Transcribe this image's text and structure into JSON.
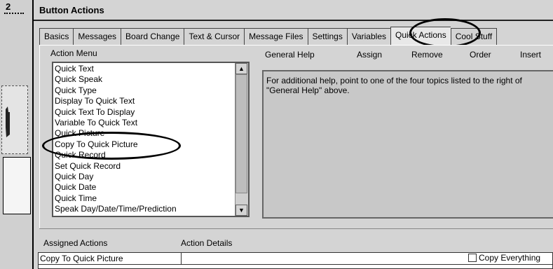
{
  "sidebar": {
    "page_number": "2"
  },
  "window": {
    "title": "Button Actions"
  },
  "tabs": [
    {
      "label": "Basics"
    },
    {
      "label": "Messages"
    },
    {
      "label": "Board Change"
    },
    {
      "label": "Text & Cursor"
    },
    {
      "label": "Message Files"
    },
    {
      "label": "Settings"
    },
    {
      "label": "Variables"
    },
    {
      "label": "Quick Actions"
    },
    {
      "label": "Cool Stuff"
    }
  ],
  "action_menu": {
    "label": "Action Menu",
    "items": [
      "Quick Text",
      "Quick Speak",
      "Quick Type",
      "Display To Quick Text",
      "Quick Text To Display",
      "Variable To Quick Text",
      "Quick Picture",
      "Copy To Quick Picture",
      "Quick Record",
      "Set Quick Record",
      "Quick Day",
      "Quick Date",
      "Quick Time",
      "Speak Day/Date/Time/Prediction"
    ]
  },
  "help": {
    "general_help": "General Help",
    "assign": "Assign",
    "remove": "Remove",
    "order": "Order",
    "insert": "Insert",
    "text": "For additional help, point to one of the four topics listed to the right of \"General Help\" above."
  },
  "assigned": {
    "col_actions": "Assigned Actions",
    "col_details": "Action Details",
    "rows": [
      {
        "action": "Copy To Quick Picture",
        "details": ""
      }
    ],
    "copy_everything_label": "Copy Everything",
    "copy_everything_checked": false
  }
}
